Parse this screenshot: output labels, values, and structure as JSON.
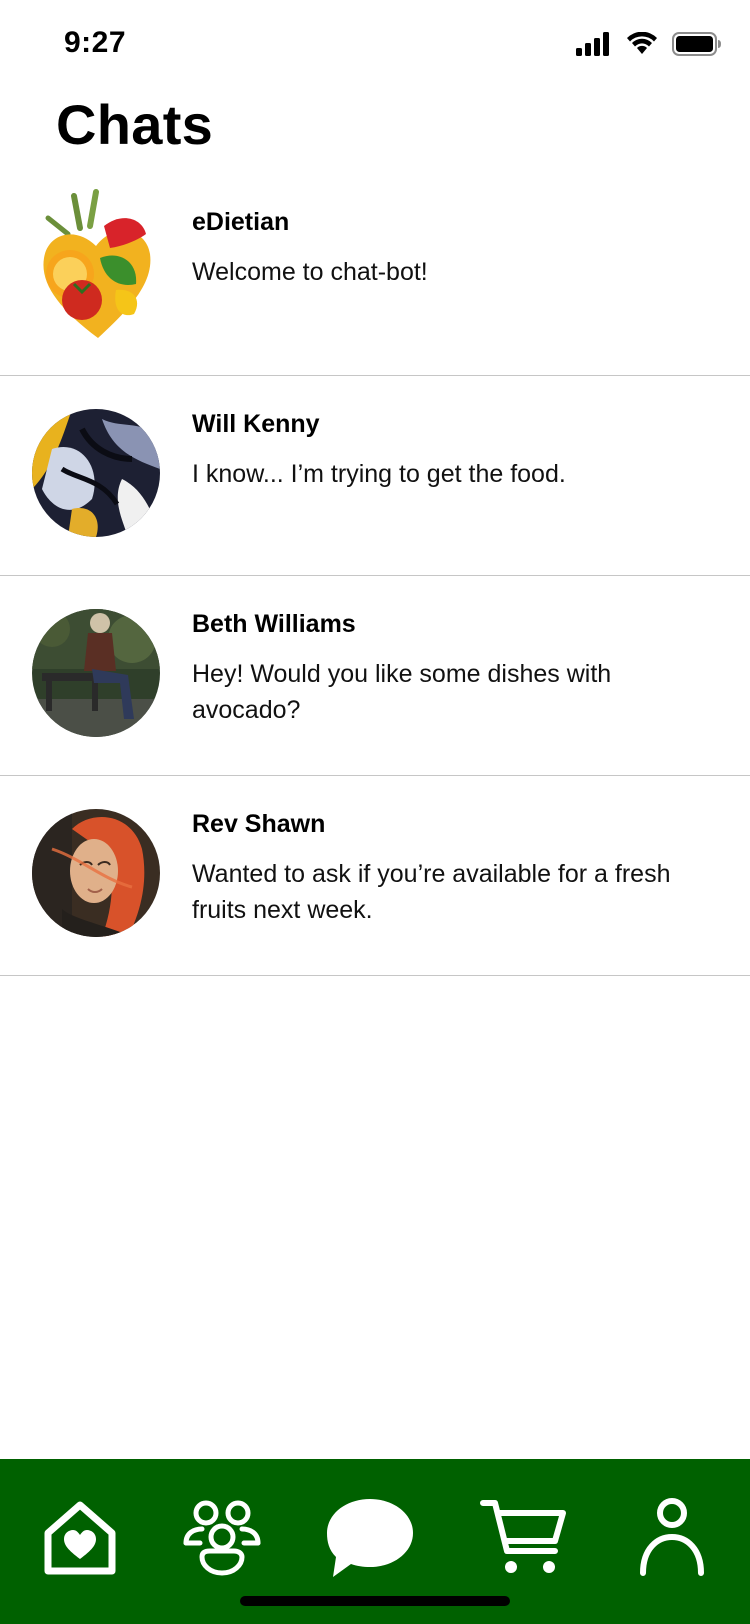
{
  "status_bar": {
    "time": "9:27",
    "icons": [
      "signal-icon",
      "wifi-icon",
      "battery-icon"
    ]
  },
  "page": {
    "title": "Chats"
  },
  "chats": [
    {
      "name": "eDietian",
      "message": "Welcome to chat-bot!",
      "avatar": "vegetable-heart-avatar"
    },
    {
      "name": "Will Kenny",
      "message": "I know... I’m trying to get the food.",
      "avatar": "marble-art-avatar"
    },
    {
      "name": "Beth Williams",
      "message": "Hey! Would you like some dishes with avocado?",
      "avatar": "park-bench-avatar"
    },
    {
      "name": "Rev Shawn",
      "message": "Wanted to ask if you’re available for a fresh fruits next week.",
      "avatar": "portrait-avatar"
    }
  ],
  "bottom_nav": {
    "items": [
      "home-heart-icon",
      "community-icon",
      "chat-bubble-icon",
      "cart-icon",
      "profile-icon"
    ],
    "active": "chat-bubble-icon"
  },
  "colors": {
    "nav_background": "#006100",
    "divider": "#c6c6c6"
  }
}
